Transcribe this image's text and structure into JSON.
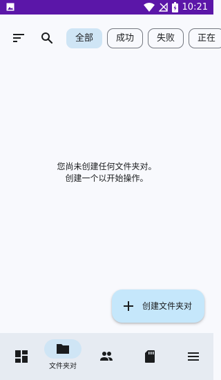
{
  "status_bar": {
    "time": "10:21"
  },
  "toolbar": {
    "filters": [
      {
        "label": "全部",
        "selected": true
      },
      {
        "label": "成功",
        "selected": false
      },
      {
        "label": "失败",
        "selected": false
      },
      {
        "label": "正在",
        "selected": false
      }
    ]
  },
  "empty_state": {
    "line1": "您尚未创建任何文件夹对。",
    "line2": "创建一个以开始操作。"
  },
  "fab": {
    "label": "创建文件夹对"
  },
  "bottom_nav": {
    "items": [
      {
        "icon": "dashboard-icon",
        "label": "",
        "active": false
      },
      {
        "icon": "folder-icon",
        "label": "文件夹对",
        "active": true
      },
      {
        "icon": "people-icon",
        "label": "",
        "active": false
      },
      {
        "icon": "sd-card-icon",
        "label": "",
        "active": false
      },
      {
        "icon": "menu-icon",
        "label": "",
        "active": false
      }
    ]
  },
  "colors": {
    "status_bar": "#5b16a8",
    "background": "#f8f9fd",
    "selected_chip": "#cfe5f5",
    "fab": "#c5e7fb",
    "bottom_nav": "#e6ebf2"
  }
}
